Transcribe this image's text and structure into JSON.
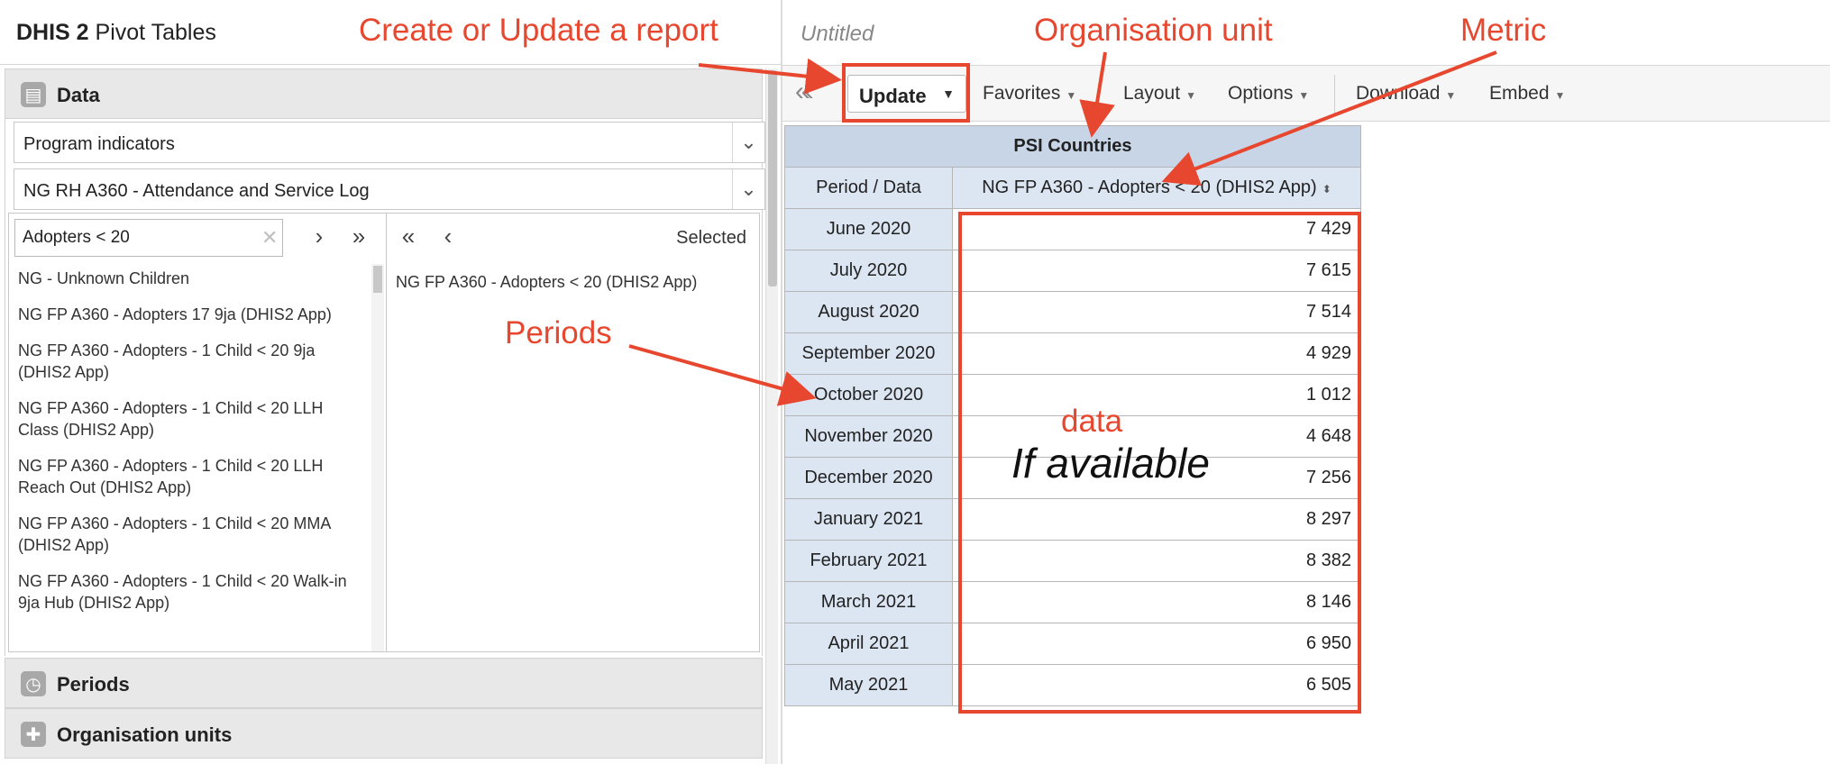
{
  "app": {
    "brand": "DHIS 2",
    "name": "Pivot Tables"
  },
  "left": {
    "sections": {
      "data": "Data",
      "periods": "Periods",
      "orgunits": "Organisation units"
    },
    "data_type": "Program indicators",
    "program": "NG RH A360 - Attendance and Service Log",
    "search": {
      "value": "Adopters < 20"
    },
    "selected_label": "Selected",
    "available": [
      "NG - Unknown Children",
      "NG FP A360 - Adopters 17 9ja (DHIS2 App)",
      "NG FP A360 - Adopters - 1 Child < 20 9ja (DHIS2 App)",
      "NG FP A360 - Adopters - 1 Child < 20 LLH Class (DHIS2 App)",
      "NG FP A360 - Adopters - 1 Child < 20 LLH Reach Out (DHIS2 App)",
      "NG FP A360 - Adopters - 1 Child < 20 MMA (DHIS2 App)",
      "NG FP A360 - Adopters - 1 Child < 20 Walk-in 9ja Hub (DHIS2 App)"
    ],
    "selected": [
      "NG FP A360 - Adopters < 20 (DHIS2 App)"
    ]
  },
  "right": {
    "title": "Untitled",
    "toolbar": {
      "update": "Update",
      "favorites": "Favorites",
      "layout": "Layout",
      "options": "Options",
      "download": "Download",
      "embed": "Embed"
    },
    "table": {
      "org_unit": "PSI Countries",
      "corner": "Period / Data",
      "metric": "NG FP A360 - Adopters < 20 (DHIS2 App)",
      "rows": [
        {
          "period": "June 2020",
          "value": "7 429"
        },
        {
          "period": "July 2020",
          "value": "7 615"
        },
        {
          "period": "August 2020",
          "value": "7 514"
        },
        {
          "period": "September 2020",
          "value": "4 929"
        },
        {
          "period": "October 2020",
          "value": "1 012"
        },
        {
          "period": "November 2020",
          "value": "4 648"
        },
        {
          "period": "December 2020",
          "value": "7 256"
        },
        {
          "period": "January 2021",
          "value": "8 297"
        },
        {
          "period": "February 2021",
          "value": "8 382"
        },
        {
          "period": "March 2021",
          "value": "8 146"
        },
        {
          "period": "April 2021",
          "value": "6 950"
        },
        {
          "period": "May 2021",
          "value": "6 505"
        }
      ]
    }
  },
  "annotations": {
    "create_update": "Create or Update a report",
    "org_unit": "Organisation unit",
    "metric": "Metric",
    "periods": "Periods",
    "data": "data",
    "if_available": "If available",
    "color": "#e8472f"
  },
  "colors": {
    "header_blue": "#c8d5e6",
    "cell_blue": "#dce6f2"
  }
}
